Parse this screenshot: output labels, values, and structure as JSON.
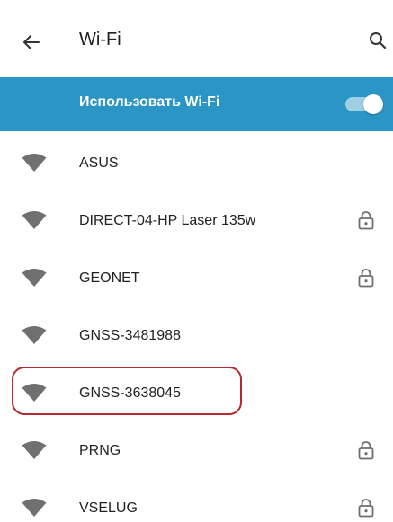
{
  "header": {
    "title": "Wi-Fi",
    "back_icon": "arrow-left-icon",
    "search_icon": "search-icon"
  },
  "toggle": {
    "label": "Использовать Wi-Fi",
    "enabled": true
  },
  "networks": [
    {
      "name": "ASUS",
      "secured": false
    },
    {
      "name": "DIRECT-04-HP Laser 135w",
      "secured": true
    },
    {
      "name": "GEONET",
      "secured": true
    },
    {
      "name": "GNSS-3481988",
      "secured": false
    },
    {
      "name": "GNSS-3638045",
      "secured": false,
      "highlighted": true
    },
    {
      "name": "PRNG",
      "secured": true
    },
    {
      "name": "VSELUG",
      "secured": true
    }
  ],
  "colors": {
    "accent_bar": "#2b95c5",
    "switch_track": "#ffffff",
    "switch_thumb": "#ffffff",
    "wifi_icon": "#707070",
    "lock_icon": "#6e6e6e",
    "highlight": "#b32a33"
  }
}
